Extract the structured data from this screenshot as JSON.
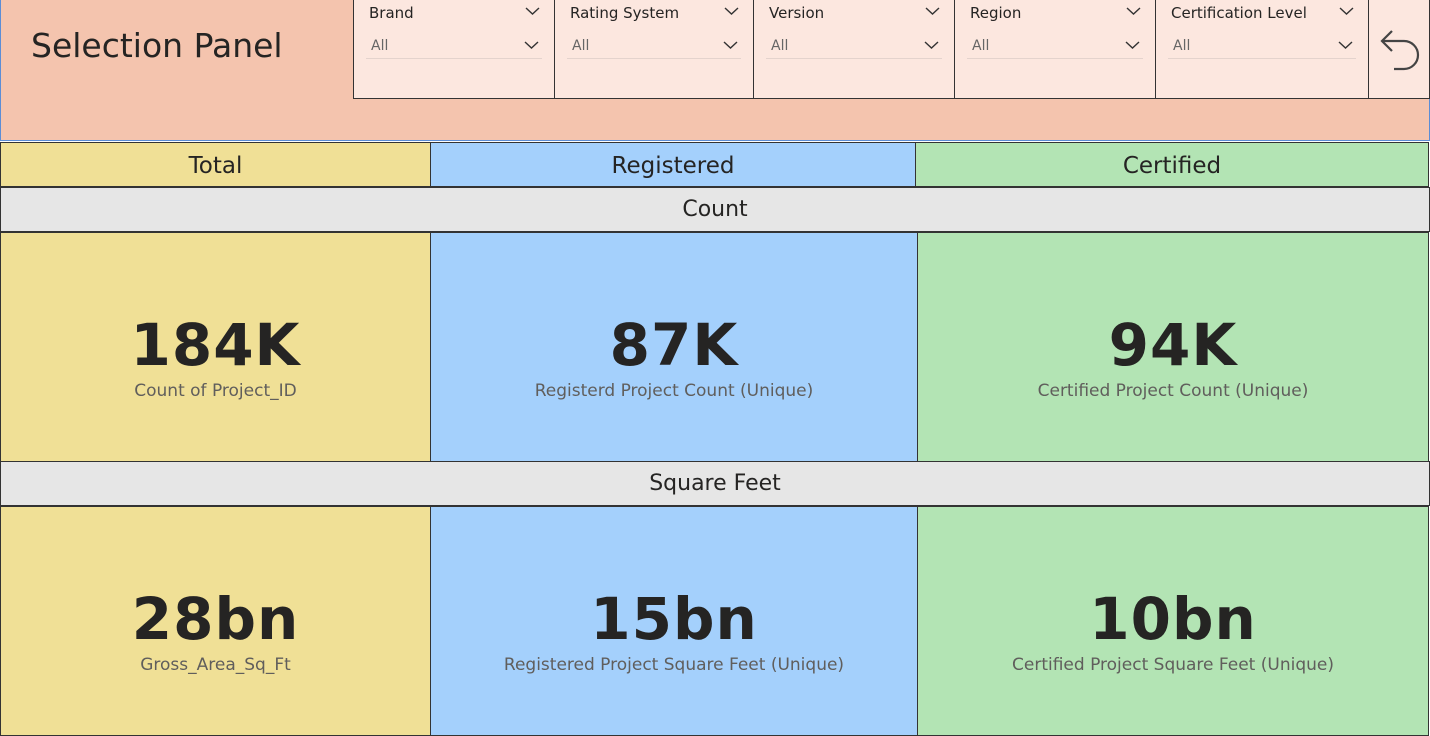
{
  "panel": {
    "title": "Selection Panel"
  },
  "slicers": [
    {
      "label": "Brand",
      "value": "All"
    },
    {
      "label": "Rating System",
      "value": "All"
    },
    {
      "label": "Version",
      "value": "All"
    },
    {
      "label": "Region",
      "value": "All"
    },
    {
      "label": "Certification Level",
      "value": "All"
    }
  ],
  "icons": {
    "undo": "undo-icon",
    "chevron": "chevron-down-icon"
  },
  "columns": {
    "total": "Total",
    "registered": "Registered",
    "certified": "Certified"
  },
  "colors": {
    "total": "#f0e096",
    "registered": "#a4d0fc",
    "certified": "#b3e4b4",
    "panel": "#f4c4ae",
    "slicer": "#fce7df",
    "section": "#e6e6e6"
  },
  "sections": {
    "count": {
      "title": "Count",
      "cards": [
        {
          "value": "184K",
          "caption": "Count of Project_ID"
        },
        {
          "value": "87K",
          "caption": "Registerd Project Count (Unique)"
        },
        {
          "value": "94K",
          "caption": "Certified Project Count (Unique)"
        }
      ]
    },
    "square_feet": {
      "title": "Square Feet",
      "cards": [
        {
          "value": "28bn",
          "caption": "Gross_Area_Sq_Ft"
        },
        {
          "value": "15bn",
          "caption": "Registered Project Square Feet (Unique)"
        },
        {
          "value": "10bn",
          "caption": "Certified Project Square Feet (Unique)"
        }
      ]
    }
  }
}
